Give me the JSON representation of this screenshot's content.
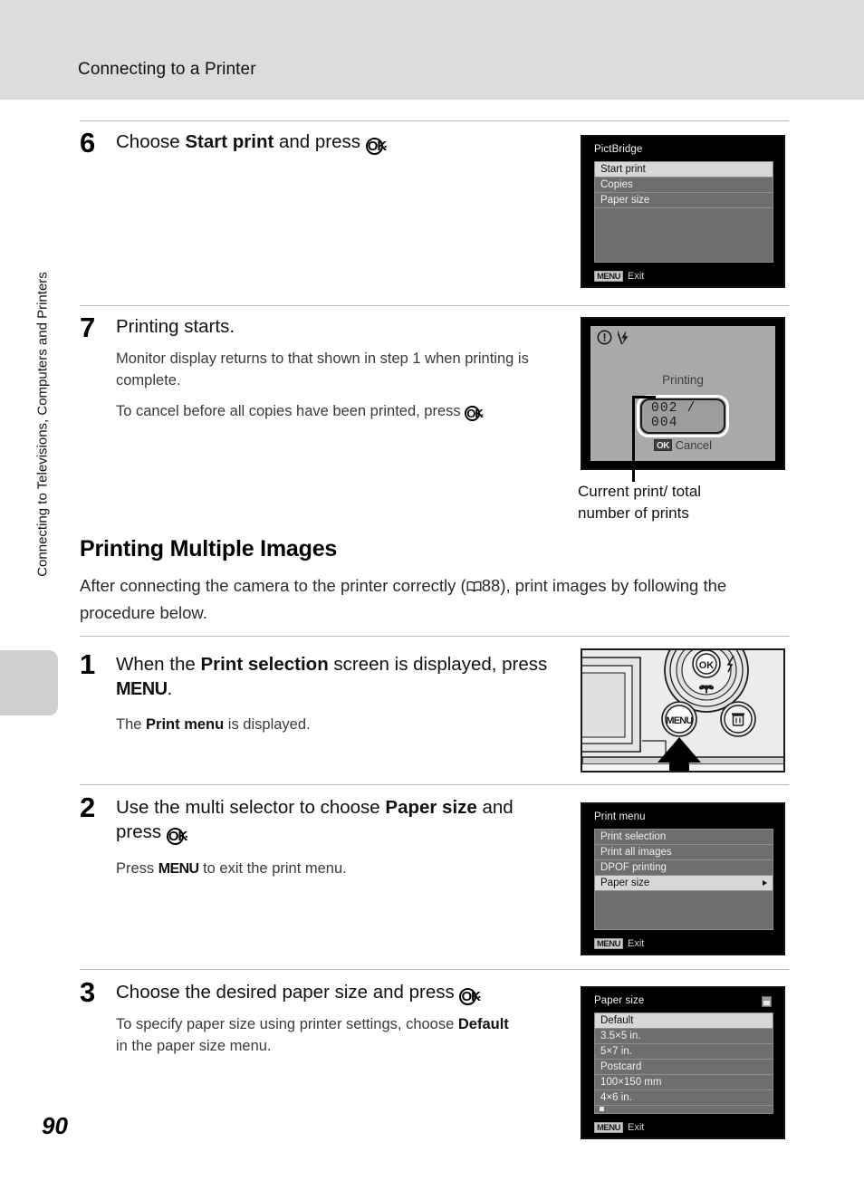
{
  "header": {
    "title": "Connecting to a Printer"
  },
  "sidebar": {
    "vertical_text": "Connecting to Televisions, Computers and Printers"
  },
  "footer": {
    "page_number": "90"
  },
  "steps": [
    {
      "number": "6",
      "heading_pre": "Choose ",
      "heading_bold": "Start print",
      "heading_post": " and press ",
      "heading_end": "."
    },
    {
      "number": "7",
      "heading": "Printing starts.",
      "body1": "Monitor display returns to that shown in step 1 when printing is complete.",
      "body2_pre": "To cancel before all copies have been printed, press ",
      "body2_post": "."
    }
  ],
  "section": {
    "heading": "Printing Multiple Images",
    "paragraph_pre": "After connecting the camera to the printer correctly (",
    "paragraph_ref": "88",
    "paragraph_post": "), print images by following the procedure below."
  },
  "multi_steps": [
    {
      "number": "1",
      "heading_pre": "When the ",
      "heading_bold": "Print selection",
      "heading_post": " screen is displayed, press ",
      "heading_menu": "MENU",
      "heading_end": ".",
      "body_pre": "The ",
      "body_bold": "Print menu",
      "body_post": " is displayed."
    },
    {
      "number": "2",
      "heading_pre": "Use the multi selector to choose ",
      "heading_bold": "Paper size",
      "heading_post": " and press ",
      "heading_end": ".",
      "body_pre": "Press ",
      "body_menu": "MENU",
      "body_post": " to exit the print menu."
    },
    {
      "number": "3",
      "heading": "Choose the desired paper size and press ",
      "heading_end": ".",
      "body_pre": "To specify paper size using printer settings, choose ",
      "body_bold": "Default",
      "body_post": " in the paper size menu."
    }
  ],
  "screens": {
    "pictbridge": {
      "title": "PictBridge",
      "rows": [
        {
          "label": "Start print",
          "selected": true
        },
        {
          "label": "Copies",
          "selected": false
        },
        {
          "label": "Paper size",
          "selected": false
        }
      ],
      "footer_badge": "MENU",
      "footer_label": "Exit"
    },
    "printing": {
      "label": "Printing",
      "count": "002 / 004",
      "cancel_badge": "OK",
      "cancel_label": "Cancel",
      "icon_warning": "warning-icon",
      "icon_noflash": "flash-off-icon"
    },
    "print_menu": {
      "title": "Print menu",
      "rows": [
        {
          "label": "Print selection",
          "selected": false,
          "arrow": false
        },
        {
          "label": "Print all images",
          "selected": false,
          "arrow": false
        },
        {
          "label": "DPOF printing",
          "selected": false,
          "arrow": false
        },
        {
          "label": "Paper size",
          "selected": true,
          "arrow": true
        }
      ],
      "footer_badge": "MENU",
      "footer_label": "Exit"
    },
    "paper_size": {
      "title": "Paper size",
      "rows": [
        {
          "label": "Default",
          "selected": true
        },
        {
          "label": "3.5×5 in.",
          "selected": false
        },
        {
          "label": "5×7 in.",
          "selected": false
        },
        {
          "label": "Postcard",
          "selected": false
        },
        {
          "label": "100×150 mm",
          "selected": false
        },
        {
          "label": "4×6 in.",
          "selected": false
        }
      ],
      "footer_badge": "MENU",
      "footer_label": "Exit"
    }
  },
  "callout": {
    "line1": "Current print/ total",
    "line2": "number of prints"
  },
  "camera_back": {
    "menu_button_label": "MENU",
    "ok_button_label": "OK",
    "delete_icon": "trash-icon",
    "macro_icon": "macro-flower-icon"
  }
}
